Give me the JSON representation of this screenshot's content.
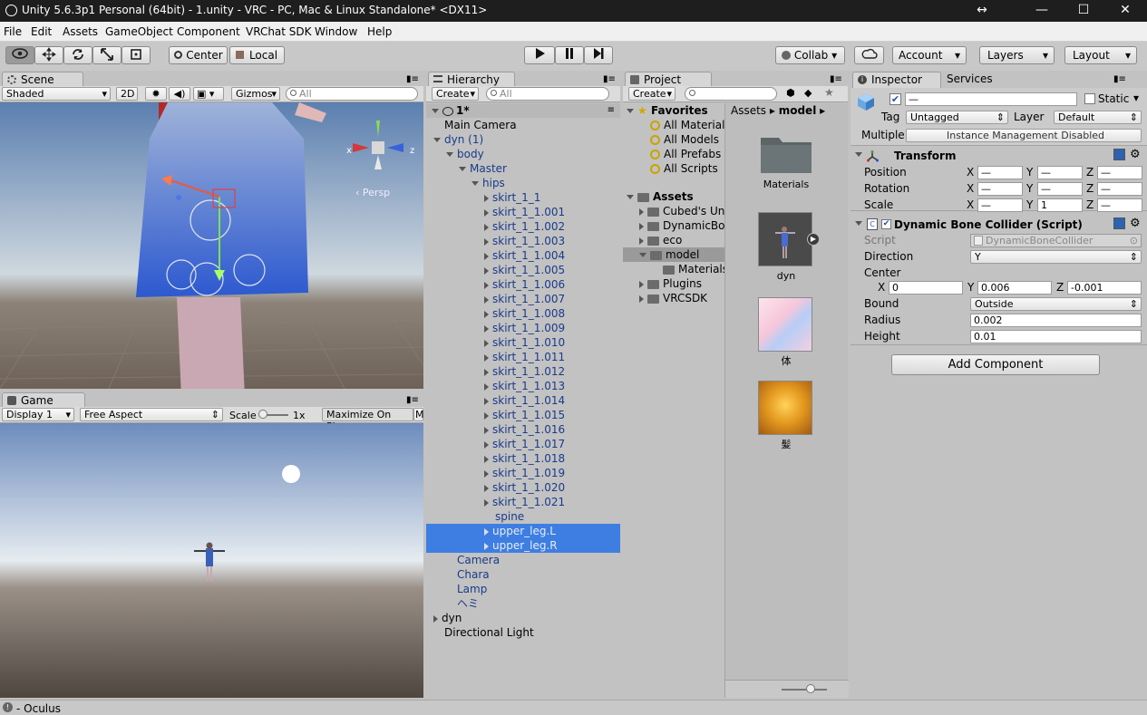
{
  "title": "Unity 5.6.3p1 Personal (64bit) - 1.unity - VRC - PC, Mac & Linux Standalone* <DX11>",
  "window_buttons": {
    "drag": "↔",
    "minimize": "—",
    "maximize": "☐",
    "close": "✕"
  },
  "menu": [
    "File",
    "Edit",
    "Assets",
    "GameObject",
    "Component",
    "VRChat SDK",
    "Window",
    "Help"
  ],
  "toolbar": {
    "center": "Center",
    "local": "Local",
    "collab": "Collab ▾",
    "account": "Account",
    "layers": "Layers",
    "layout": "Layout"
  },
  "scene": {
    "tab": "Scene",
    "shading": "Shaded",
    "mode2d": "2D",
    "gizmos": "Gizmos",
    "search_placeholder": "All",
    "persp": "Persp",
    "axis_x": "x",
    "axis_z": "z"
  },
  "game": {
    "tab": "Game",
    "display": "Display 1",
    "aspect": "Free Aspect",
    "scale_label": "Scale",
    "scale_value": "1x",
    "maximize": "Maximize On Play",
    "more": "M"
  },
  "hierarchy": {
    "tab": "Hierarchy",
    "create": "Create",
    "search_placeholder": "All",
    "scene_name": "1*",
    "rows": [
      {
        "label": "Main Camera",
        "indent": 1,
        "arrow": "",
        "color": "black",
        "selected": false
      },
      {
        "label": "dyn (1)",
        "indent": 1,
        "arrow": "down",
        "color": "blue",
        "selected": false
      },
      {
        "label": "body",
        "indent": 2,
        "arrow": "down",
        "color": "blue",
        "selected": false
      },
      {
        "label": "Master",
        "indent": 3,
        "arrow": "down",
        "color": "blue",
        "selected": false
      },
      {
        "label": "hips",
        "indent": 4,
        "arrow": "down",
        "color": "blue",
        "selected": false
      },
      {
        "label": "skirt_1_1",
        "indent": 5,
        "arrow": "right",
        "color": "blue",
        "selected": false
      },
      {
        "label": "skirt_1_1.001",
        "indent": 5,
        "arrow": "right",
        "color": "blue",
        "selected": false
      },
      {
        "label": "skirt_1_1.002",
        "indent": 5,
        "arrow": "right",
        "color": "blue",
        "selected": false
      },
      {
        "label": "skirt_1_1.003",
        "indent": 5,
        "arrow": "right",
        "color": "blue",
        "selected": false
      },
      {
        "label": "skirt_1_1.004",
        "indent": 5,
        "arrow": "right",
        "color": "blue",
        "selected": false
      },
      {
        "label": "skirt_1_1.005",
        "indent": 5,
        "arrow": "right",
        "color": "blue",
        "selected": false
      },
      {
        "label": "skirt_1_1.006",
        "indent": 5,
        "arrow": "right",
        "color": "blue",
        "selected": false
      },
      {
        "label": "skirt_1_1.007",
        "indent": 5,
        "arrow": "right",
        "color": "blue",
        "selected": false
      },
      {
        "label": "skirt_1_1.008",
        "indent": 5,
        "arrow": "right",
        "color": "blue",
        "selected": false
      },
      {
        "label": "skirt_1_1.009",
        "indent": 5,
        "arrow": "right",
        "color": "blue",
        "selected": false
      },
      {
        "label": "skirt_1_1.010",
        "indent": 5,
        "arrow": "right",
        "color": "blue",
        "selected": false
      },
      {
        "label": "skirt_1_1.011",
        "indent": 5,
        "arrow": "right",
        "color": "blue",
        "selected": false
      },
      {
        "label": "skirt_1_1.012",
        "indent": 5,
        "arrow": "right",
        "color": "blue",
        "selected": false
      },
      {
        "label": "skirt_1_1.013",
        "indent": 5,
        "arrow": "right",
        "color": "blue",
        "selected": false
      },
      {
        "label": "skirt_1_1.014",
        "indent": 5,
        "arrow": "right",
        "color": "blue",
        "selected": false
      },
      {
        "label": "skirt_1_1.015",
        "indent": 5,
        "arrow": "right",
        "color": "blue",
        "selected": false
      },
      {
        "label": "skirt_1_1.016",
        "indent": 5,
        "arrow": "right",
        "color": "blue",
        "selected": false
      },
      {
        "label": "skirt_1_1.017",
        "indent": 5,
        "arrow": "right",
        "color": "blue",
        "selected": false
      },
      {
        "label": "skirt_1_1.018",
        "indent": 5,
        "arrow": "right",
        "color": "blue",
        "selected": false
      },
      {
        "label": "skirt_1_1.019",
        "indent": 5,
        "arrow": "right",
        "color": "blue",
        "selected": false
      },
      {
        "label": "skirt_1_1.020",
        "indent": 5,
        "arrow": "right",
        "color": "blue",
        "selected": false
      },
      {
        "label": "skirt_1_1.021",
        "indent": 5,
        "arrow": "right",
        "color": "blue",
        "selected": false
      },
      {
        "label": "spine",
        "indent": 5,
        "arrow": "",
        "color": "blue",
        "selected": false
      },
      {
        "label": "upper_leg.L",
        "indent": 5,
        "arrow": "right",
        "color": "blue",
        "selected": true
      },
      {
        "label": "upper_leg.R",
        "indent": 5,
        "arrow": "right",
        "color": "blue",
        "selected": true
      },
      {
        "label": "Camera",
        "indent": 2,
        "arrow": "",
        "color": "blue",
        "selected": false
      },
      {
        "label": "Chara",
        "indent": 2,
        "arrow": "",
        "color": "blue",
        "selected": false
      },
      {
        "label": "Lamp",
        "indent": 2,
        "arrow": "",
        "color": "blue",
        "selected": false
      },
      {
        "label": "ヘミ",
        "indent": 2,
        "arrow": "",
        "color": "blue",
        "selected": false
      },
      {
        "label": "dyn",
        "indent": 1,
        "arrow": "right",
        "color": "black",
        "selected": false
      },
      {
        "label": "Directional Light",
        "indent": 1,
        "arrow": "",
        "color": "black",
        "selected": false
      }
    ]
  },
  "project": {
    "tab": "Project",
    "create": "Create",
    "favorites": "Favorites",
    "fav_items": [
      "All Materials",
      "All Models",
      "All Prefabs",
      "All Scripts"
    ],
    "assets": "Assets",
    "asset_folders": [
      "Cubed's Unity Shaders",
      "DynamicBone",
      "eco",
      "model",
      "Materials",
      "Plugins",
      "VRCSDK"
    ],
    "breadcrumb_root": "Assets",
    "breadcrumb_current": "model",
    "thumbs": [
      "Materials",
      "dyn",
      "体",
      "髪"
    ]
  },
  "inspector": {
    "tab": "Inspector",
    "services": "Services",
    "name_value": "—",
    "static_label": "Static",
    "tag_label": "Tag",
    "tag_value": "Untagged",
    "layer_label": "Layer",
    "layer_value": "Default",
    "multiple_label": "Multiple",
    "multiple_value": "Instance Management Disabled",
    "transform": {
      "title": "Transform",
      "position": "Position",
      "rotation": "Rotation",
      "scale": "Scale",
      "dash": "—",
      "scale_y": "1"
    },
    "collider": {
      "title": "Dynamic Bone Collider (Script)",
      "script_label": "Script",
      "script_value": "DynamicBoneCollider",
      "direction_label": "Direction",
      "direction_value": "Y",
      "center_label": "Center",
      "cx": "0",
      "cy": "0.006",
      "cz": "-0.001",
      "bound_label": "Bound",
      "bound_value": "Outside",
      "radius_label": "Radius",
      "radius_value": "0.002",
      "height_label": "Height",
      "height_value": "0.01"
    },
    "add_component": "Add Component",
    "axis": [
      "X",
      "Y",
      "Z"
    ]
  },
  "status": "- Oculus"
}
